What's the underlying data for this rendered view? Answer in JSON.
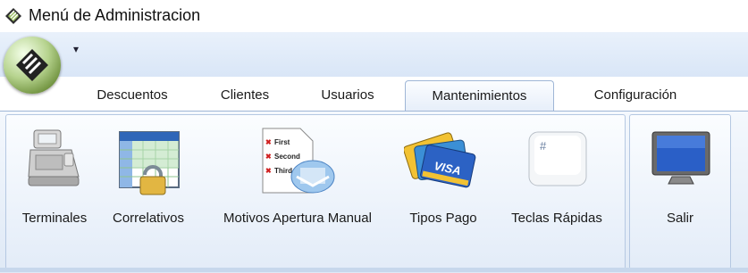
{
  "window": {
    "title": "Menú de Administracion",
    "app_icon": "app-logo-icon"
  },
  "quick_access": {
    "menu_glyph": "▾"
  },
  "tabs": [
    {
      "label": "Descuentos",
      "active": false
    },
    {
      "label": "Clientes",
      "active": false
    },
    {
      "label": "Usuarios",
      "active": false
    },
    {
      "label": "Mantenimientos",
      "active": true
    },
    {
      "label": "Configuración",
      "active": false
    }
  ],
  "ribbon": {
    "buttons": [
      {
        "label": "Terminales",
        "icon": "cash-register-icon"
      },
      {
        "label": "Correlativos",
        "icon": "locked-spreadsheet-icon"
      },
      {
        "label": "Motivos Apertura Manual",
        "icon": "reasons-list-icon"
      },
      {
        "label": "Tipos Pago",
        "icon": "credit-cards-icon"
      },
      {
        "label": "Teclas Rápidas",
        "icon": "key-icon"
      }
    ],
    "exit_button": {
      "label": "Salir",
      "icon": "monitor-icon"
    }
  },
  "document_list_words": [
    "First",
    "Second",
    "Third"
  ],
  "card_brand": "VISA",
  "key_symbol": "#"
}
